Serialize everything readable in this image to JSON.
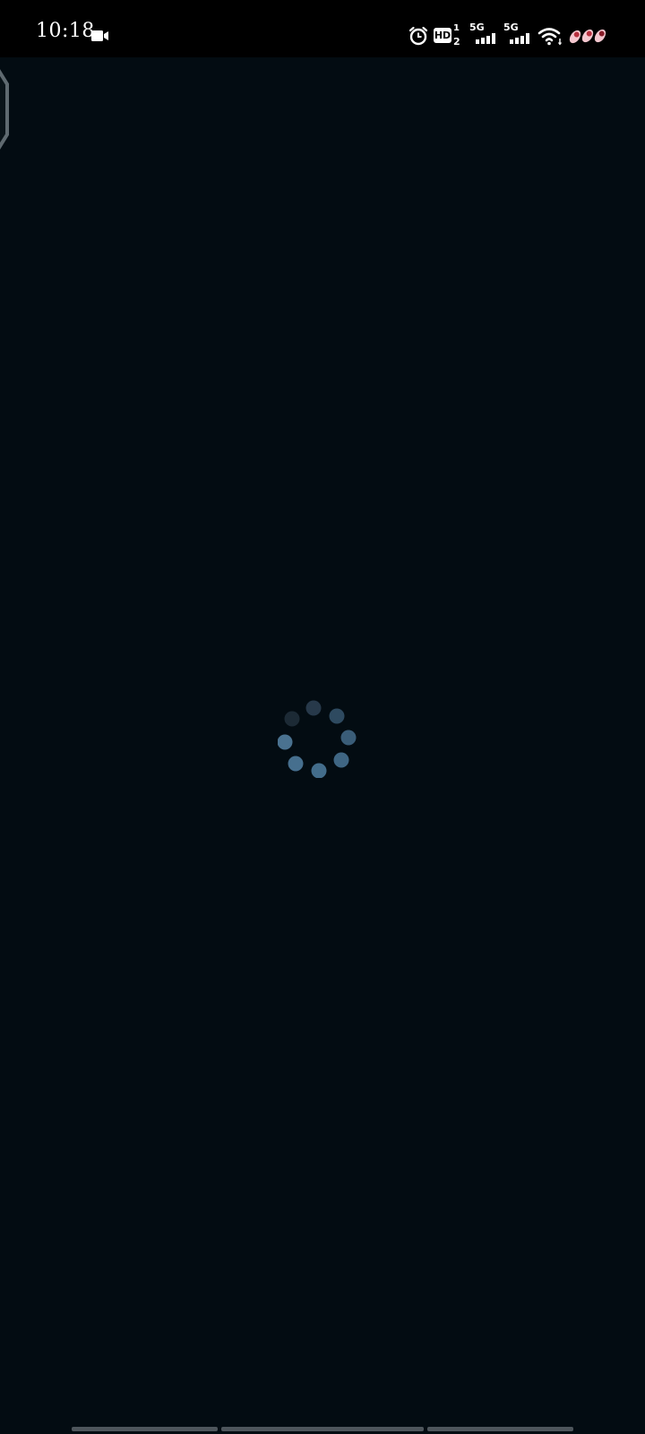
{
  "status_bar": {
    "time": "10:18",
    "hd_label": "HD",
    "hd_superscript": "1",
    "hd_subscript": "2",
    "sim1_network": "5G",
    "sim2_network": "5G",
    "icons": [
      "video-recording-icon",
      "alarm-icon",
      "hd-voice-icon",
      "signal-strength-icon",
      "wifi-icon",
      "notification-icon"
    ]
  },
  "loading": {
    "state": "loading",
    "indicator": "spinner-icon"
  },
  "colors": {
    "background": "#030c12",
    "status_bar": "#000000",
    "spinner_dot": "#4a7290",
    "nav_bar": "#4e565c"
  }
}
